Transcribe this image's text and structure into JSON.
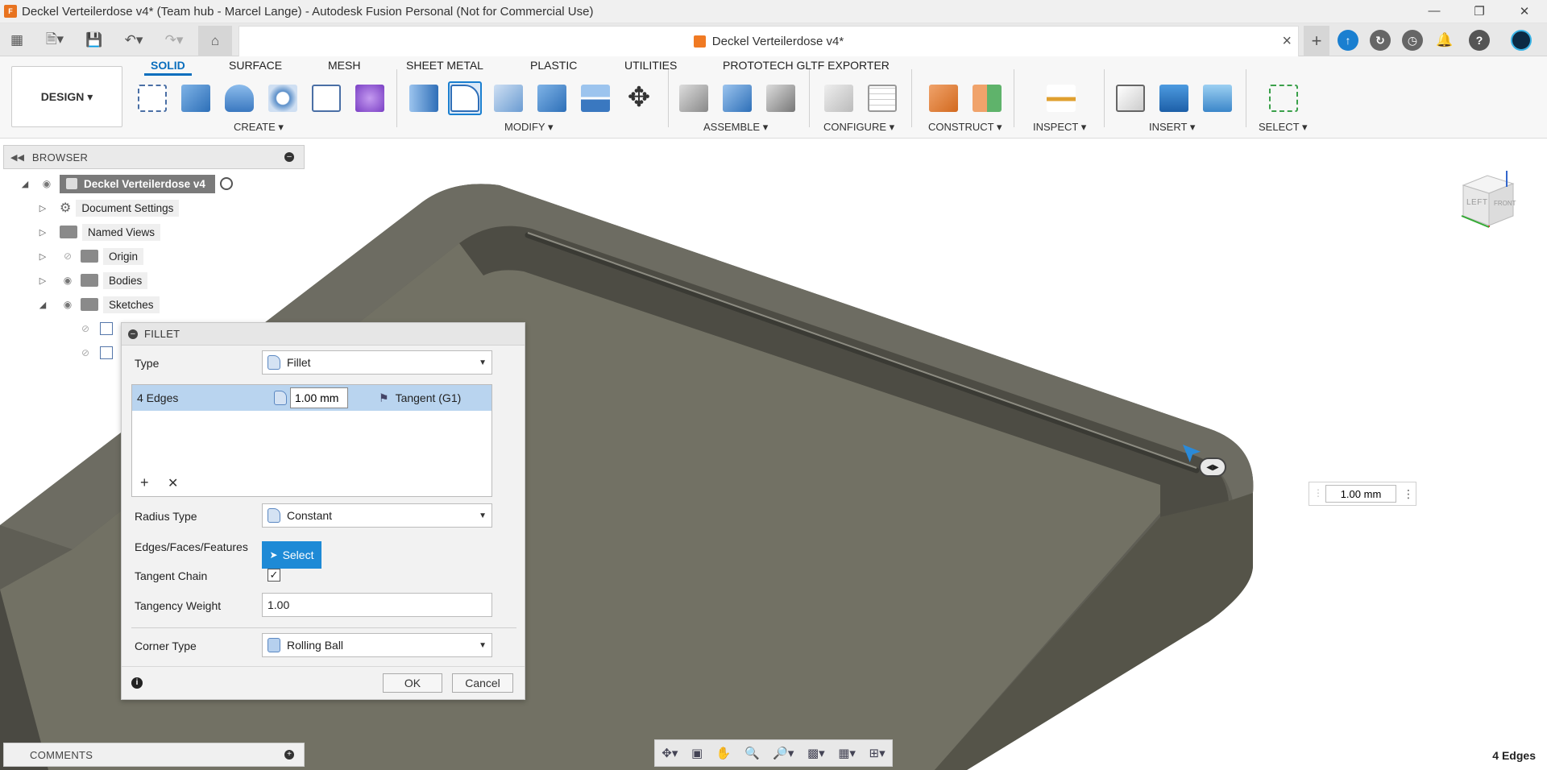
{
  "titlebar": {
    "title": "Deckel Verteilerdose v4* (Team hub - Marcel Lange) - Autodesk Fusion Personal (Not for Commercial Use)",
    "app_icon_text": "F"
  },
  "doc_tab": {
    "name": "Deckel Verteilerdose v4*"
  },
  "workspace": {
    "label": "DESIGN"
  },
  "ribbon_tabs": [
    "SOLID",
    "SURFACE",
    "MESH",
    "SHEET METAL",
    "PLASTIC",
    "UTILITIES",
    "PROTOTECH GLTF EXPORTER"
  ],
  "ribbon_groups": [
    "CREATE",
    "MODIFY",
    "ASSEMBLE",
    "CONFIGURE",
    "CONSTRUCT",
    "INSPECT",
    "INSERT",
    "SELECT"
  ],
  "browser": {
    "title": "BROWSER",
    "root": "Deckel Verteilerdose v4",
    "items": [
      "Document Settings",
      "Named Views",
      "Origin",
      "Bodies",
      "Sketches"
    ]
  },
  "fillet": {
    "title": "FILLET",
    "type_label": "Type",
    "type_value": "Fillet",
    "edges_label": "4 Edges",
    "radius_value": "1.00 mm",
    "continuity": "Tangent (G1)",
    "radius_type_label": "Radius Type",
    "radius_type_value": "Constant",
    "edges_faces_label": "Edges/Faces/Features",
    "select_label": "Select",
    "tangent_chain_label": "Tangent Chain",
    "tangent_chain_checked": true,
    "tangency_weight_label": "Tangency Weight",
    "tangency_weight_value": "1.00",
    "corner_type_label": "Corner Type",
    "corner_type_value": "Rolling Ball",
    "ok_label": "OK",
    "cancel_label": "Cancel"
  },
  "viewcube": {
    "face_left": "LEFT",
    "face_front": "FRONT"
  },
  "radius_input": {
    "value": "1.00 mm"
  },
  "comments": {
    "title": "COMMENTS"
  },
  "status": {
    "text": "4 Edges"
  },
  "colors": {
    "accent": "#0a6ebd",
    "select_btn": "#1e8ad6",
    "body": "#6b6a5e"
  }
}
